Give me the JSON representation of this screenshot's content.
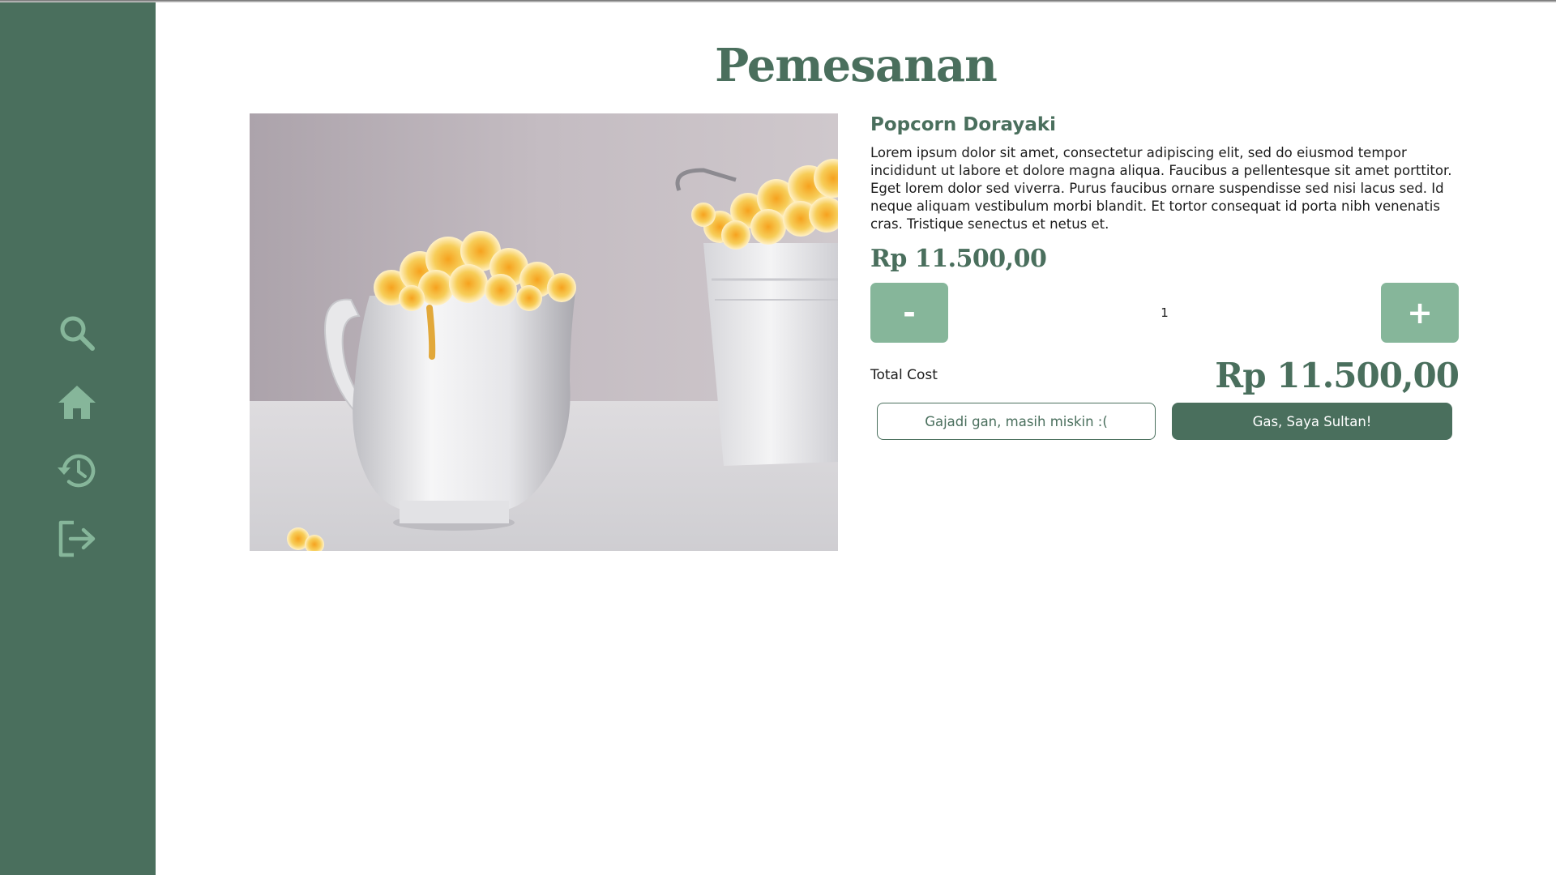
{
  "page": {
    "title": "Pemesanan"
  },
  "sidebar": {
    "background": "#4a6f5d",
    "icon_color": "#86b69a",
    "items": [
      {
        "icon": "search-icon"
      },
      {
        "icon": "home-icon"
      },
      {
        "icon": "history-icon"
      },
      {
        "icon": "logout-icon"
      }
    ]
  },
  "product": {
    "name": "Popcorn Dorayaki",
    "description": "Lorem ipsum dolor sit amet, consectetur adipiscing elit, sed do eiusmod tempor incididunt ut labore et dolore magna aliqua. Faucibus a pellentesque sit amet porttitor. Eget lorem dolor sed viverra. Purus faucibus ornare suspendisse sed nisi lacus sed. Id neque aliquam vestibulum morbi blandit. Et tortor consequat id porta nibh venenatis cras. Tristique senectus et netus et.",
    "price": "Rp 11.500,00",
    "image": "popcorn-pitcher-photo"
  },
  "quantity": {
    "minus_label": "-",
    "value": "1",
    "plus_label": "+"
  },
  "total": {
    "label": "Total Cost",
    "value": "Rp 11.500,00"
  },
  "actions": {
    "cancel_label": "Gajadi gan, masih miskin :(",
    "confirm_label": "Gas, Saya Sultan!"
  },
  "colors": {
    "primary": "#4a6f5d",
    "accent": "#86b69a"
  }
}
